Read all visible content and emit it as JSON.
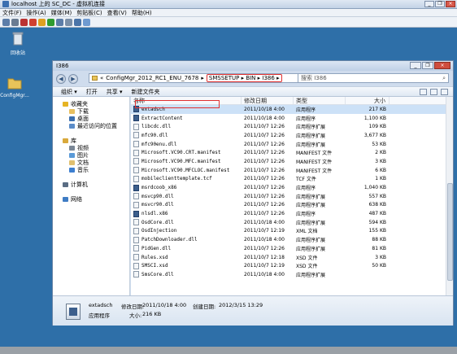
{
  "vm": {
    "title": "localhost 上的 SC_DC - 虚拟机连接",
    "menu": [
      "文件(F)",
      "操作(A)",
      "媒体(M)",
      "剪贴板(C)",
      "查看(V)",
      "帮助(H)"
    ],
    "controls": {
      "close": "×",
      "restore": "❐",
      "minimize": "_"
    }
  },
  "desktop": {
    "icons": [
      {
        "label": "回收站"
      },
      {
        "label": "ConfigMgr..."
      }
    ]
  },
  "explorer": {
    "title": "I386",
    "address": {
      "prefix": "«",
      "crumbs": [
        "ConfigMgr_2012_RC1_ENU_7678",
        "SMSSETUP",
        "BIN",
        "I386"
      ],
      "separator": "▸"
    },
    "search_placeholder": "搜索 I386",
    "toolbar": [
      "组织 ▾",
      "打开",
      "共享 ▾",
      "新建文件夹"
    ],
    "nav": [
      {
        "label": "收藏夹",
        "level": 0,
        "icon": "star-icon",
        "color": "#e6b423"
      },
      {
        "label": "下载",
        "level": 1,
        "icon": "download-folder-icon",
        "color": "#e8c060"
      },
      {
        "label": "桌面",
        "level": 1,
        "icon": "desktop-icon",
        "color": "#3b6fb0"
      },
      {
        "label": "最近访问的位置",
        "level": 1,
        "icon": "recent-places-icon",
        "color": "#5b8cc8"
      },
      {
        "label": "",
        "level": -1
      },
      {
        "label": "库",
        "level": 0,
        "icon": "libraries-icon",
        "color": "#d9a93c"
      },
      {
        "label": "视频",
        "level": 1,
        "icon": "videos-icon",
        "color": "#7a8796"
      },
      {
        "label": "图片",
        "level": 1,
        "icon": "pictures-icon",
        "color": "#5a9ad8"
      },
      {
        "label": "文档",
        "level": 1,
        "icon": "documents-icon",
        "color": "#e0c070"
      },
      {
        "label": "音乐",
        "level": 1,
        "icon": "music-icon",
        "color": "#3d7fd0"
      },
      {
        "label": "",
        "level": -1
      },
      {
        "label": "计算机",
        "level": 0,
        "icon": "computer-icon",
        "color": "#5a6d84"
      },
      {
        "label": "",
        "level": -1
      },
      {
        "label": "网络",
        "level": 0,
        "icon": "network-icon",
        "color": "#3f7cc4"
      }
    ],
    "columns": [
      "名称",
      "修改日期",
      "类型",
      "大小"
    ],
    "files": [
      {
        "name": "extadsch",
        "date": "2011/10/18 4:00",
        "type": "应用程序",
        "size": "217 KB",
        "icon": "exe",
        "selected": true
      },
      {
        "name": "ExtractContent",
        "date": "2011/10/18 4:00",
        "type": "应用程序",
        "size": "1,100 KB",
        "icon": "exe"
      },
      {
        "name": "libcdc.dll",
        "date": "2011/10/7 12:26",
        "type": "应用程序扩展",
        "size": "109 KB",
        "icon": "dll"
      },
      {
        "name": "mfc90.dll",
        "date": "2011/10/7 12:26",
        "type": "应用程序扩展",
        "size": "3,677 KB",
        "icon": "dll"
      },
      {
        "name": "mfc90enu.dll",
        "date": "2011/10/7 12:26",
        "type": "应用程序扩展",
        "size": "53 KB",
        "icon": "dll"
      },
      {
        "name": "Microsoft.VC90.CRT.manifest",
        "date": "2011/10/7 12:26",
        "type": "MANIFEST 文件",
        "size": "2 KB",
        "icon": "doc"
      },
      {
        "name": "Microsoft.VC90.MFC.manifest",
        "date": "2011/10/7 12:26",
        "type": "MANIFEST 文件",
        "size": "3 KB",
        "icon": "doc"
      },
      {
        "name": "Microsoft.VC90.MFCLOC.manifest",
        "date": "2011/10/7 12:26",
        "type": "MANIFEST 文件",
        "size": "6 KB",
        "icon": "doc"
      },
      {
        "name": "mobileclienttemplate.tcf",
        "date": "2011/10/7 12:26",
        "type": "TCF 文件",
        "size": "1 KB",
        "icon": "doc"
      },
      {
        "name": "msrdcoob_x86",
        "date": "2011/10/7 12:26",
        "type": "应用程序",
        "size": "1,040 KB",
        "icon": "exe"
      },
      {
        "name": "msvcp90.dll",
        "date": "2011/10/7 12:26",
        "type": "应用程序扩展",
        "size": "557 KB",
        "icon": "dll"
      },
      {
        "name": "msvcr90.dll",
        "date": "2011/10/7 12:26",
        "type": "应用程序扩展",
        "size": "638 KB",
        "icon": "dll"
      },
      {
        "name": "nlsdl.x86",
        "date": "2011/10/7 12:26",
        "type": "应用程序",
        "size": "487 KB",
        "icon": "exe"
      },
      {
        "name": "OsdCore.dll",
        "date": "2011/10/18 4:00",
        "type": "应用程序扩展",
        "size": "594 KB",
        "icon": "dll"
      },
      {
        "name": "OsdInjection",
        "date": "2011/10/7 12:19",
        "type": "XML 文档",
        "size": "155 KB",
        "icon": "doc"
      },
      {
        "name": "PatchDownloader.dll",
        "date": "2011/10/18 4:00",
        "type": "应用程序扩展",
        "size": "88 KB",
        "icon": "dll"
      },
      {
        "name": "PidGen.dll",
        "date": "2011/10/7 12:26",
        "type": "应用程序扩展",
        "size": "81 KB",
        "icon": "dll"
      },
      {
        "name": "Rules.xsd",
        "date": "2011/10/7 12:18",
        "type": "XSD 文件",
        "size": "3 KB",
        "icon": "doc"
      },
      {
        "name": "SMSCI.xsd",
        "date": "2011/10/7 12:19",
        "type": "XSD 文件",
        "size": "50 KB",
        "icon": "doc"
      },
      {
        "name": "SmsCore.dll",
        "date": "2011/10/18 4:00",
        "type": "应用程序扩展",
        "size": "",
        "icon": "dll"
      }
    ],
    "details": {
      "name": "extadsch",
      "type": "应用程序",
      "modified_label": "修改日期:",
      "modified": "2011/10/18 4:00",
      "created_label": "创建日期:",
      "created": "2012/3/15 13:29",
      "size_label": "大小:",
      "size": "216 KB"
    }
  }
}
